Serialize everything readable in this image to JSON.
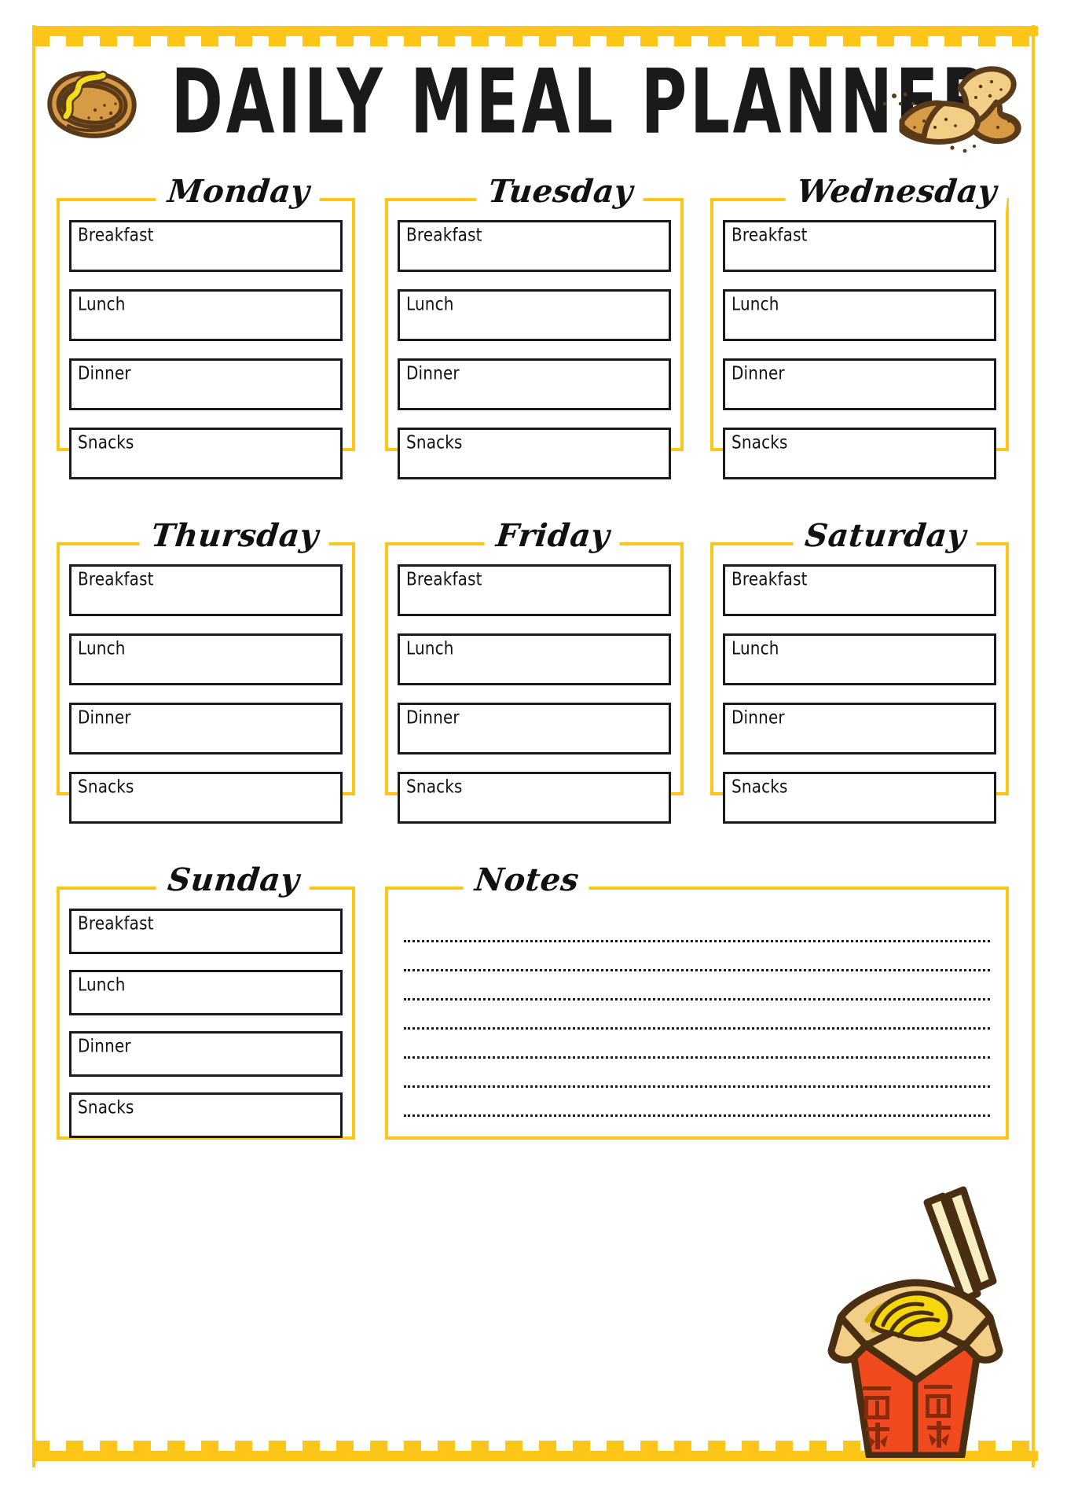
{
  "page": {
    "title": "DAILY MEAL PLANNER",
    "accent_color": "#FFC61A",
    "ink_color": "#1b1b1b",
    "background": "#ffffff"
  },
  "decorations": [
    {
      "name": "hotdog-illustration",
      "label": "hot dog with mustard"
    },
    {
      "name": "potato-chips-illustration",
      "label": "potato chips"
    },
    {
      "name": "noodle-box-illustration",
      "label": "takeout noodle box with chopsticks",
      "characters": "面条"
    }
  ],
  "meal_labels": [
    "Breakfast",
    "Lunch",
    "Dinner",
    "Snacks"
  ],
  "days": [
    {
      "name": "Monday",
      "meals": [
        "Breakfast",
        "Lunch",
        "Dinner",
        "Snacks"
      ]
    },
    {
      "name": "Tuesday",
      "meals": [
        "Breakfast",
        "Lunch",
        "Dinner",
        "Snacks"
      ]
    },
    {
      "name": "Wednesday",
      "meals": [
        "Breakfast",
        "Lunch",
        "Dinner",
        "Snacks"
      ]
    },
    {
      "name": "Thursday",
      "meals": [
        "Breakfast",
        "Lunch",
        "Dinner",
        "Snacks"
      ]
    },
    {
      "name": "Friday",
      "meals": [
        "Breakfast",
        "Lunch",
        "Dinner",
        "Snacks"
      ]
    },
    {
      "name": "Saturday",
      "meals": [
        "Breakfast",
        "Lunch",
        "Dinner",
        "Snacks"
      ]
    },
    {
      "name": "Sunday",
      "meals": [
        "Breakfast",
        "Lunch",
        "Dinner",
        "Snacks"
      ]
    }
  ],
  "notes": {
    "title": "Notes",
    "line_count": 7,
    "lines": [
      "",
      "",
      "",
      "",
      "",
      "",
      ""
    ]
  }
}
